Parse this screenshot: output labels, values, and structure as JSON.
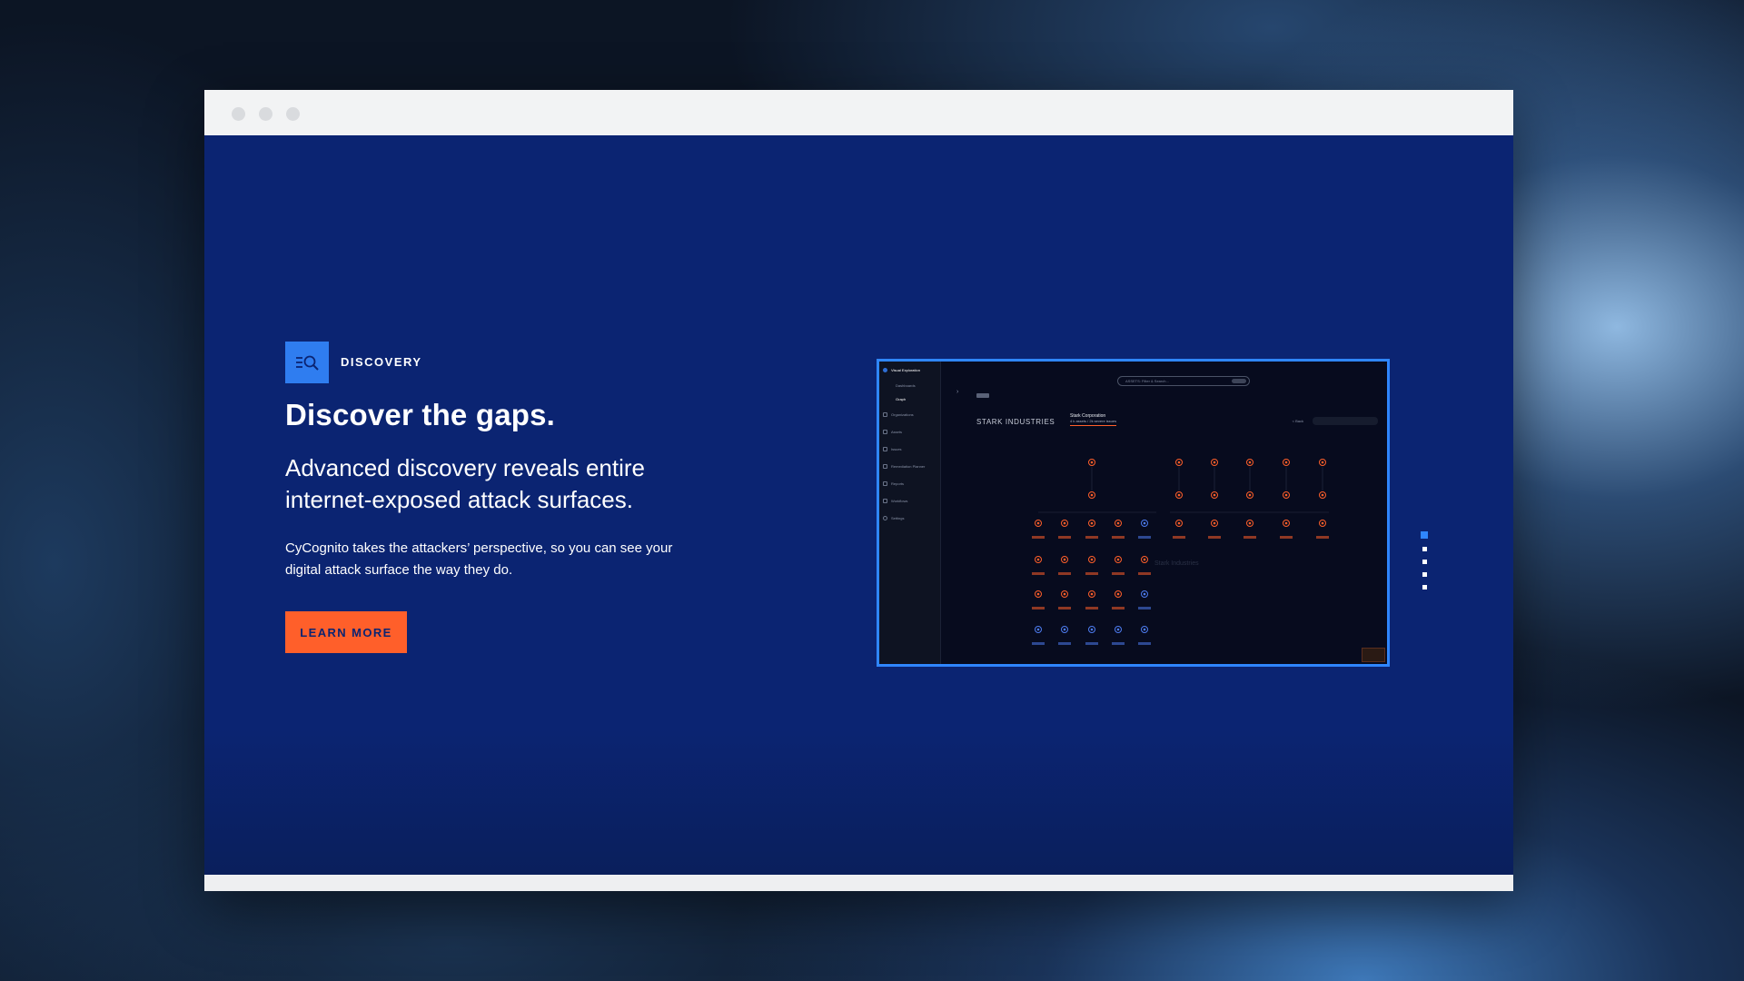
{
  "section": {
    "label": "DISCOVERY",
    "icon": "magnifier-list-icon",
    "heading": "Discover the gaps.",
    "subheading": "Advanced discovery reveals entire internet-exposed attack surfaces.",
    "body": "CyCognito takes the attackers’ perspective, so you can see your digital attack surface the way they do.",
    "cta_label": "LEARN MORE"
  },
  "colors": {
    "page_blue": "#0b2472",
    "accent_blue": "#2f7df0",
    "cta_orange": "#ff5f2a"
  },
  "screenshot": {
    "sidebar": {
      "group": "Visual Exploration",
      "sub_items": [
        {
          "label": "Dashboards",
          "active": false
        },
        {
          "label": "Graph",
          "active": true
        }
      ],
      "items": [
        "Organizations",
        "Assets",
        "Issues",
        "Remediation Planner",
        "Reports",
        "Workflows",
        "Settings"
      ]
    },
    "search_placeholder": "ASSETS: Filter & Search...",
    "breadcrumb_org": "STARK INDUSTRIES",
    "breadcrumb_target": "Stark Corporation",
    "breadcrumb_target_sub": "4 k assets / 2k severe issues",
    "back_label": "< Back",
    "watermark": "Stark Industries"
  },
  "pager": {
    "count": 5,
    "active_index": 0
  }
}
